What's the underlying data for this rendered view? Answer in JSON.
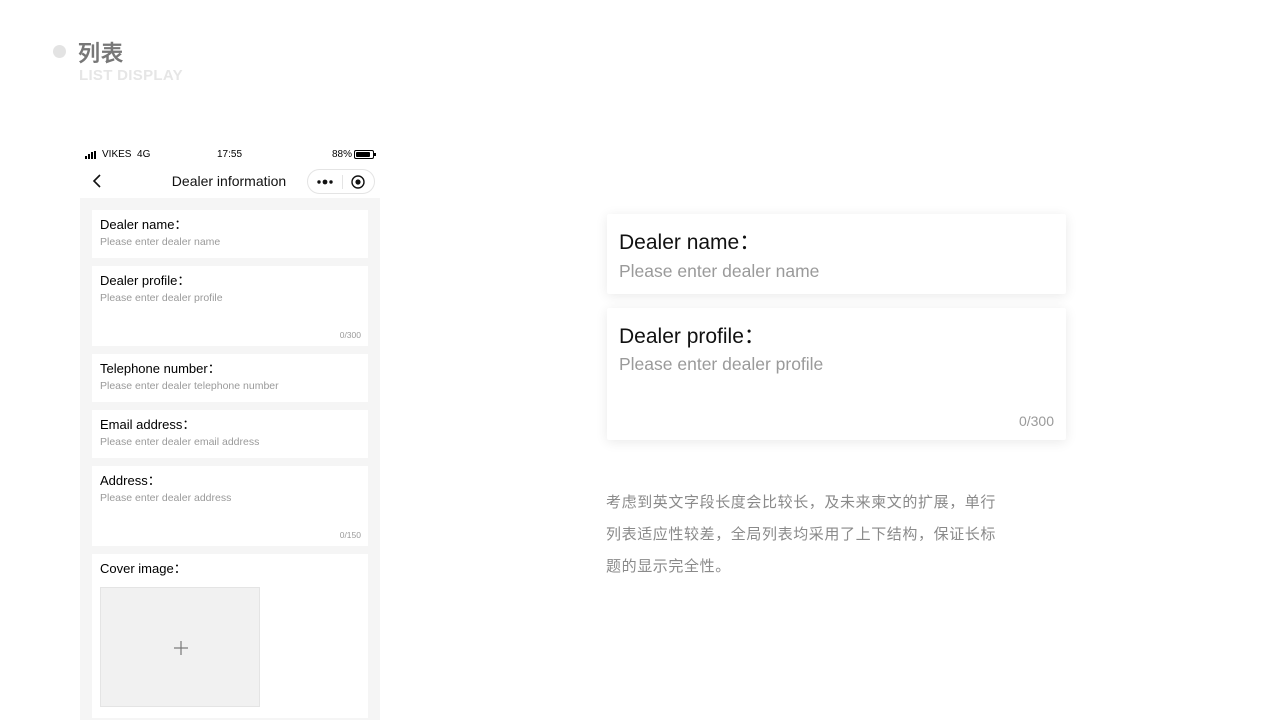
{
  "header": {
    "title": "列表",
    "subtitle": "LIST DISPLAY"
  },
  "phone": {
    "status_bar": {
      "carrier": "VIKES",
      "network": "4G",
      "time": "17:55",
      "battery": "88%",
      "battery_level": 0.88
    },
    "nav": {
      "title": "Dealer information",
      "icons": [
        "back-arrow-icon",
        "more-dots-icon",
        "close-target-icon"
      ]
    },
    "fields": [
      {
        "label": "Dealer name：",
        "placeholder": "Please enter dealer name"
      },
      {
        "label": "Dealer profile：",
        "placeholder": "Please enter dealer profile",
        "counter": "0/300"
      },
      {
        "label": "Telephone  number：",
        "placeholder": "Please enter dealer telephone  number"
      },
      {
        "label": "Email address：",
        "placeholder": "Please enter dealer email address"
      },
      {
        "label": "Address：",
        "placeholder": "Please enter dealer address",
        "counter": "0/150"
      },
      {
        "label": "Cover image："
      }
    ]
  },
  "preview": {
    "name": {
      "label": "Dealer name：",
      "placeholder": "Please enter dealer name"
    },
    "profile": {
      "label": "Dealer profile：",
      "placeholder": "Please enter dealer profile",
      "counter": "0/300"
    }
  },
  "description": "考虑到英文字段长度会比较长，及未来柬文的扩展，单行列表适应性较差，全局列表均采用了上下结构，保证长标题的显示完全性。"
}
